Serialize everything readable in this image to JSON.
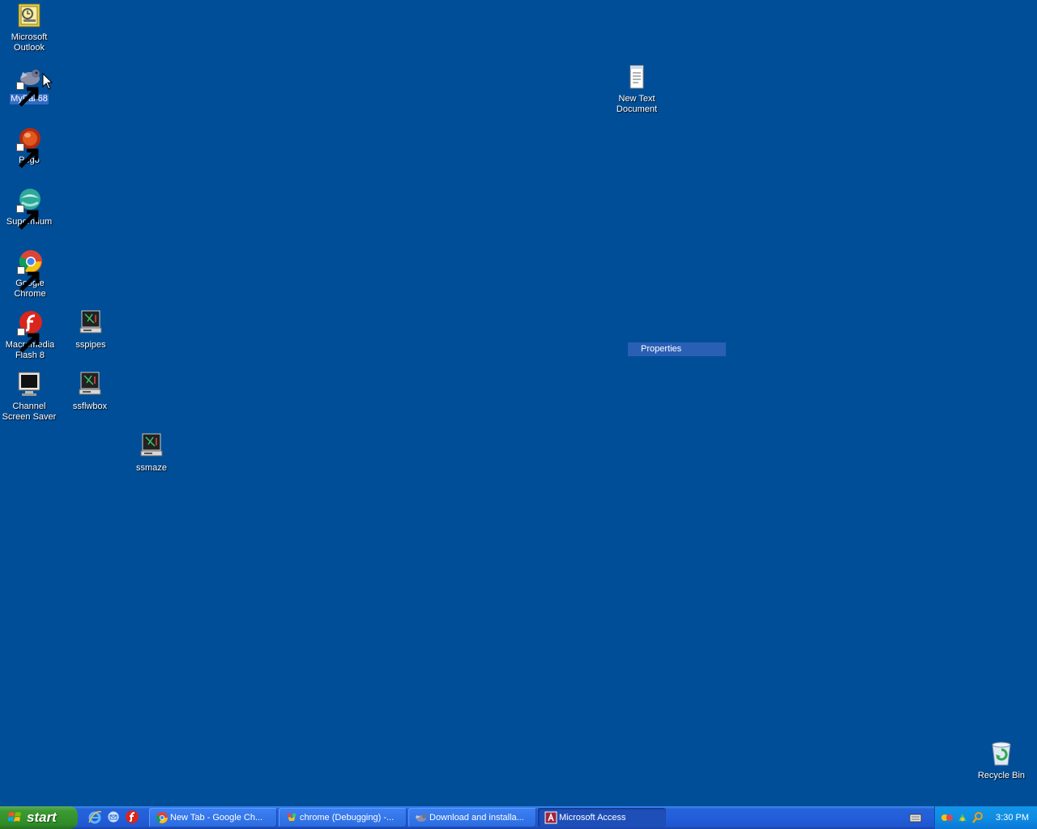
{
  "desktop": {
    "icons": [
      {
        "label": "Microsoft Outlook",
        "icon": "outlook-icon"
      },
      {
        "label": "MyPal 68",
        "icon": "mypal-icon"
      },
      {
        "label": "Pego",
        "icon": "pego-icon"
      },
      {
        "label": "Supermium",
        "icon": "supermium-icon"
      },
      {
        "label": "Google Chrome",
        "icon": "chrome-icon"
      },
      {
        "label": "Macromedia Flash 8",
        "icon": "flash-icon"
      },
      {
        "label": "sspipes",
        "icon": "screensaver-icon"
      },
      {
        "label": "Channel Screen Saver",
        "icon": "monitor-icon"
      },
      {
        "label": "ssflwbox",
        "icon": "screensaver-icon"
      },
      {
        "label": "ssmaze",
        "icon": "screensaver-icon"
      },
      {
        "label": "New Text Document",
        "icon": "text-document-icon"
      },
      {
        "label": "Recycle Bin",
        "icon": "recycle-bin-icon"
      }
    ],
    "context_menu": {
      "item": "Properties"
    }
  },
  "taskbar": {
    "start_label": "start",
    "quick_launch": [
      "internet-explorer-icon",
      "outlook-express-icon",
      "flash-icon"
    ],
    "tasks": [
      {
        "label": "New Tab - Google Ch...",
        "icon": "chrome-icon",
        "active": false
      },
      {
        "label": "chrome (Debugging) -...",
        "icon": "chrome-debug-icon",
        "active": false
      },
      {
        "label": "Download and installa...",
        "icon": "mypal-icon",
        "active": false
      },
      {
        "label": "Microsoft Access",
        "icon": "access-icon",
        "active": true
      }
    ],
    "clock": "3:30 PM"
  },
  "colors": {
    "desktop": "#004e98",
    "selection": "#316ac5",
    "taskbar": "#245edb",
    "start": "#3c9a34",
    "tray": "#0f8de3"
  }
}
